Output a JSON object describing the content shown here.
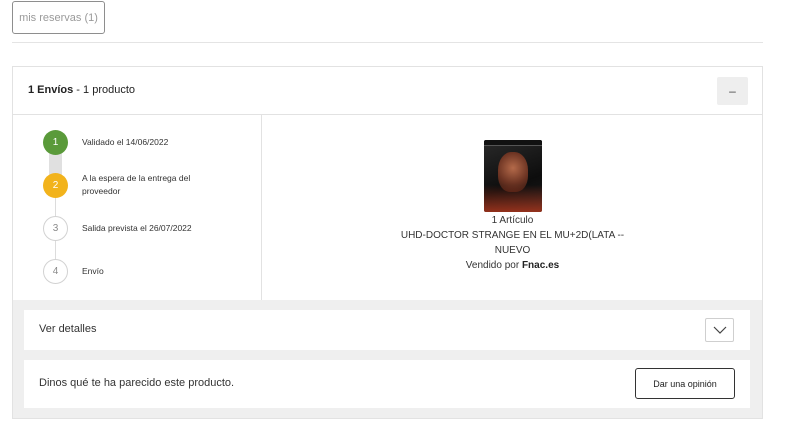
{
  "tabs": {
    "reservations_label": "mis reservas (1)"
  },
  "order": {
    "header_bold": "1 Envíos",
    "header_rest": " - 1 producto",
    "collapse_label": "–",
    "steps": [
      {
        "number": "1",
        "label": "Validado el 14/06/2022",
        "state": "done"
      },
      {
        "number": "2",
        "label": "A la espera de la entrega del proveedor",
        "state": "pending"
      },
      {
        "number": "3",
        "label": "Salida prevista el 26/07/2022",
        "state": "future"
      },
      {
        "number": "4",
        "label": "Envío",
        "state": "future"
      }
    ],
    "product": {
      "count": "1 Artículo",
      "title_line1": "UHD-DOCTOR STRANGE EN EL MU+2D(LATA --",
      "title_line2": "NUEVO",
      "seller_prefix": "Vendido por ",
      "seller": "Fnac.es"
    },
    "details_label": "Ver detalles",
    "opinion_prompt": "Dinos qué te ha parecido este producto.",
    "opinion_button": "Dar una opinión"
  },
  "colors": {
    "step_done": "#5a9a3a",
    "step_pending": "#f2b31c",
    "panel_bg": "#efefef"
  },
  "icons": [
    "chevron-down-icon",
    "minus-icon"
  ]
}
